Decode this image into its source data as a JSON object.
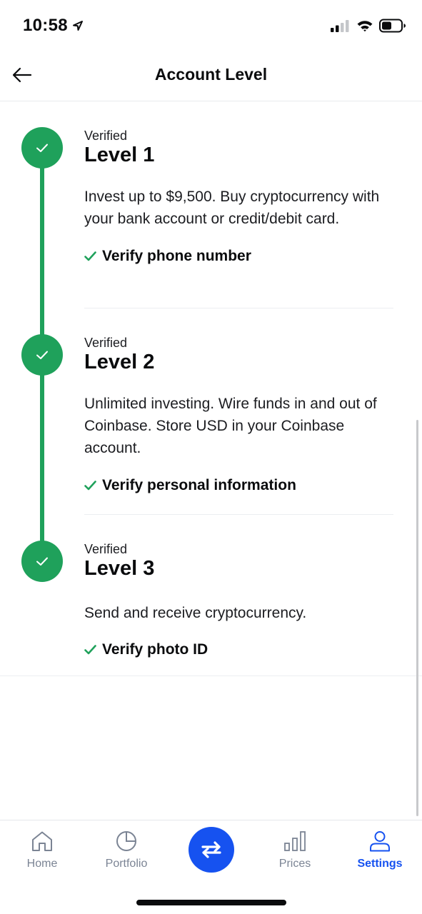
{
  "status_bar": {
    "time": "10:58"
  },
  "header": {
    "title": "Account Level",
    "back_icon": "arrow-left-icon"
  },
  "levels": [
    {
      "status": "Verified",
      "name": "Level 1",
      "description": "Invest up to $9,500. Buy cryptocurrency with your bank account or credit/debit card.",
      "requirement": "Verify phone number"
    },
    {
      "status": "Verified",
      "name": "Level 2",
      "description": "Unlimited investing. Wire funds in and out of Coinbase. Store USD in your Coinbase account.",
      "requirement": "Verify personal information"
    },
    {
      "status": "Verified",
      "name": "Level 3",
      "description": "Send and receive cryptocurrency.",
      "requirement": "Verify photo ID"
    }
  ],
  "tabs": [
    {
      "label": "Home",
      "icon": "home-icon"
    },
    {
      "label": "Portfolio",
      "icon": "pie-chart-icon"
    },
    {
      "label": "Prices",
      "icon": "bar-chart-icon"
    },
    {
      "label": "Settings",
      "icon": "user-icon",
      "active": true
    }
  ],
  "colors": {
    "verified_green": "#1fa15b",
    "brand_blue": "#1652f0",
    "inactive_tab": "#7b8494"
  }
}
